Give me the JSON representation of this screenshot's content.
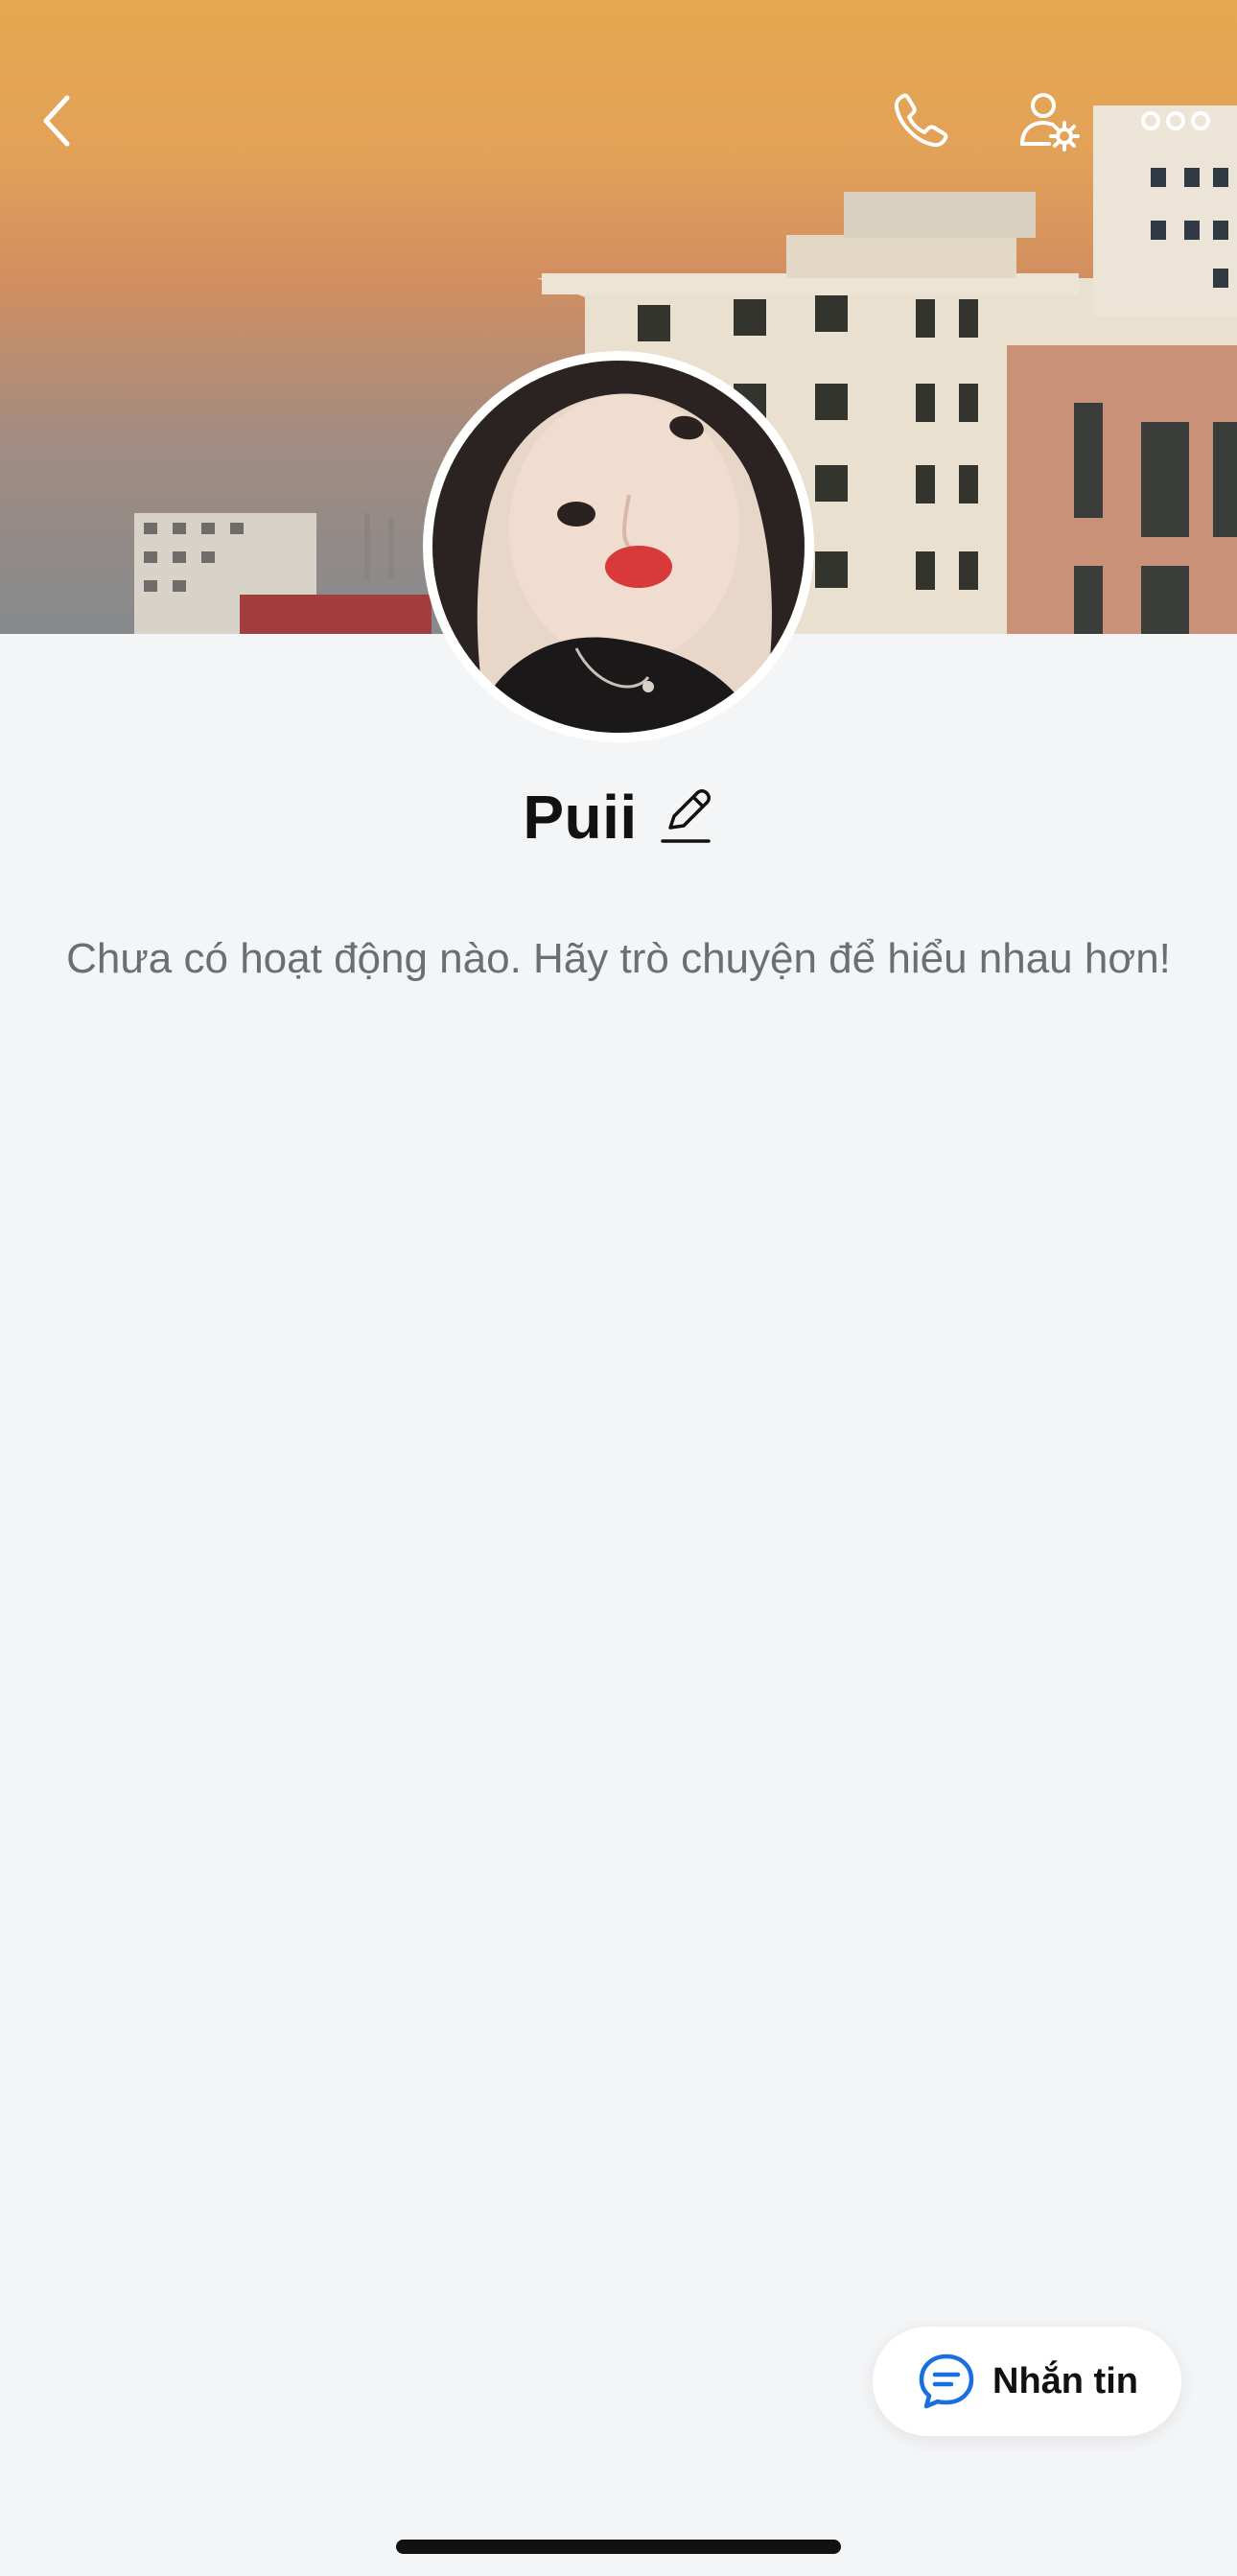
{
  "header": {
    "back_icon": "chevron-left-icon",
    "call_icon": "phone-icon",
    "settings_icon": "user-settings-icon",
    "more_icon": "more-dots-icon"
  },
  "profile": {
    "name": "Puii",
    "edit_icon": "pencil-icon",
    "activity_text": "Chưa có hoạt động nào. Hãy trò chuyện để hiểu nhau hơn!"
  },
  "message_button": {
    "label": "Nhắn tin",
    "icon": "chat-bubble-icon"
  },
  "colors": {
    "background": "#f4f5f7",
    "accent": "#1a6fe0",
    "text_primary": "#111111",
    "text_secondary": "#6b6e73"
  }
}
